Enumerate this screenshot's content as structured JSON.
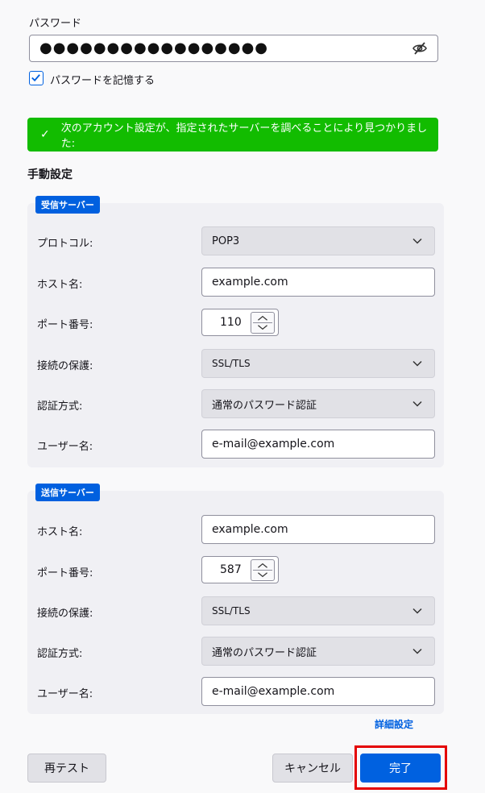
{
  "password": {
    "label": "パスワード",
    "value": "●●●●●●●●●●●●●●●●●",
    "toggle_icon": "eye-slash-icon",
    "remember_label": "パスワードを記憶する",
    "remember_checked": true
  },
  "banner": {
    "icon": "checkmark-icon",
    "text": "次のアカウント設定が、指定されたサーバーを調べることにより見つかりました:",
    "color": "#12bc00"
  },
  "manual": {
    "title": "手動設定",
    "incoming": {
      "badge": "受信サーバー",
      "rows": {
        "protocol": {
          "label": "プロトコル:",
          "value": "POP3"
        },
        "host": {
          "label": "ホスト名:",
          "value": "example.com"
        },
        "port": {
          "label": "ポート番号:",
          "value": "110"
        },
        "security": {
          "label": "接続の保護:",
          "value": "SSL/TLS"
        },
        "auth": {
          "label": "認証方式:",
          "value": "通常のパスワード認証"
        },
        "user": {
          "label": "ユーザー名:",
          "value": "e-mail@example.com"
        }
      }
    },
    "outgoing": {
      "badge": "送信サーバー",
      "rows": {
        "host": {
          "label": "ホスト名:",
          "value": "example.com"
        },
        "port": {
          "label": "ポート番号:",
          "value": "587"
        },
        "security": {
          "label": "接続の保護:",
          "value": "SSL/TLS"
        },
        "auth": {
          "label": "認証方式:",
          "value": "通常のパスワード認証"
        },
        "user": {
          "label": "ユーザー名:",
          "value": "e-mail@example.com"
        }
      }
    },
    "advanced_link": "詳細設定"
  },
  "footer": {
    "retest": "再テスト",
    "cancel": "キャンセル",
    "done": "完了",
    "accent": "#0061e0",
    "highlight_color": "#e40000"
  }
}
